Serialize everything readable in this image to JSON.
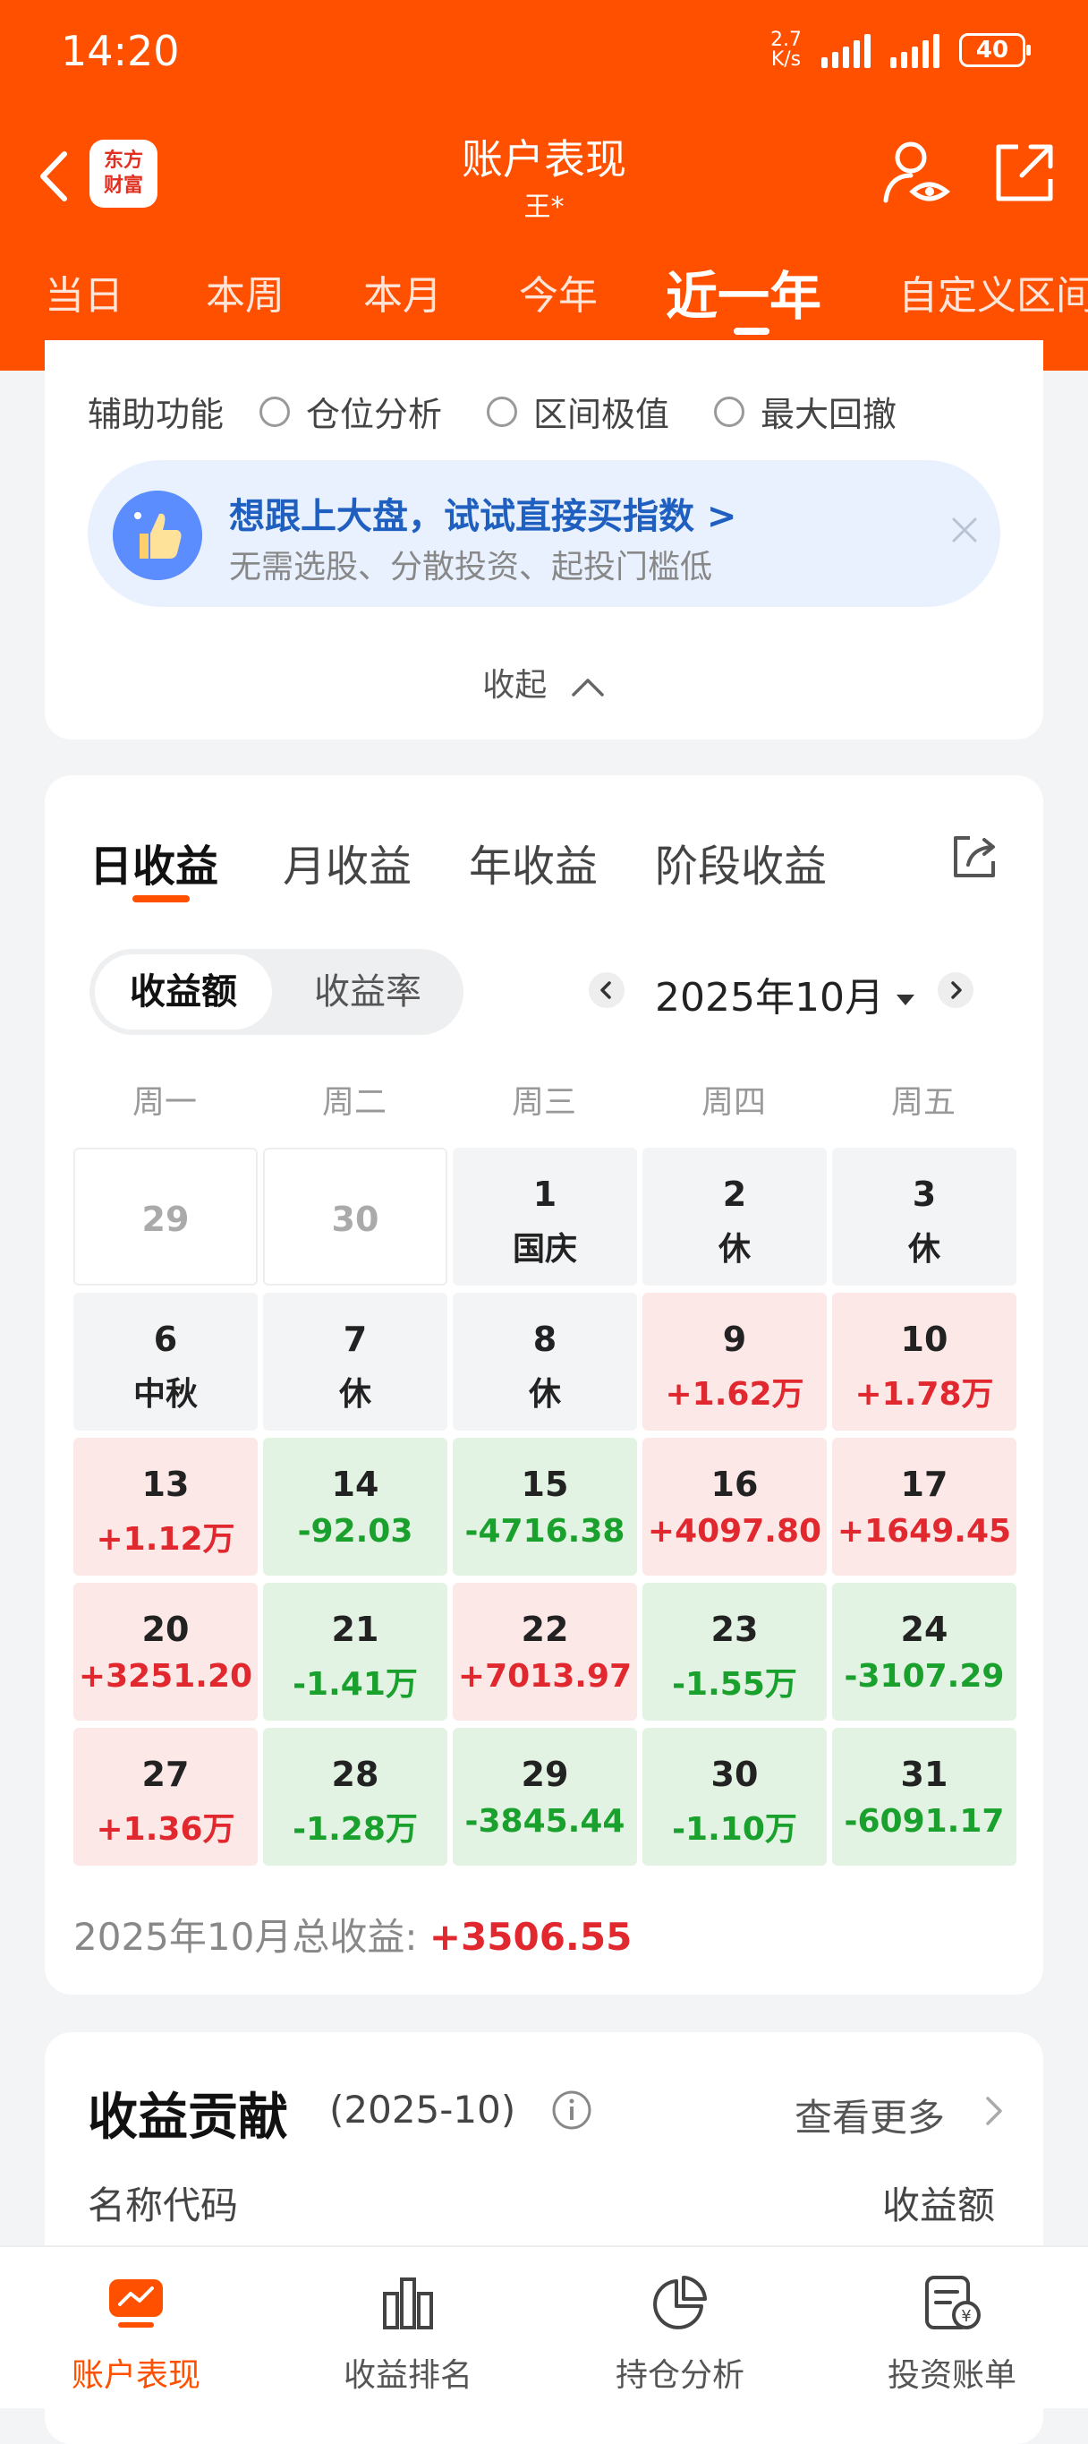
{
  "status_bar": {
    "time": "14:20",
    "net_speed": "2.7\nK/s",
    "battery": "40"
  },
  "header": {
    "brand_logo_lines": [
      "东方",
      "财富"
    ],
    "title": "账户表现",
    "subtitle": "王*",
    "icons": [
      "back-icon",
      "user-eye-icon",
      "share-icon"
    ]
  },
  "period_tabs": [
    "当日",
    "本周",
    "本月",
    "今年",
    "近一年",
    "自定义区间"
  ],
  "period_active": "近一年",
  "assist": {
    "label": "辅助功能",
    "options": [
      "仓位分析",
      "区间极值",
      "最大回撤"
    ]
  },
  "promo": {
    "title": "想跟上大盘，试试直接买指数 >",
    "subtitle": "无需选股、分散投资、起投门槛低"
  },
  "collapse_label": "收起",
  "earnings": {
    "tabs": [
      "日收益",
      "月收益",
      "年收益",
      "阶段收益"
    ],
    "active_tab": "日收益",
    "segment": [
      "收益额",
      "收益率"
    ],
    "active_segment": "收益额",
    "month": "2025年10月",
    "weekdays": [
      "周一",
      "周二",
      "周三",
      "周四",
      "周五"
    ],
    "calendar": [
      [
        {
          "day": "29",
          "val": "",
          "type": "out"
        },
        {
          "day": "30",
          "val": "",
          "type": "out"
        },
        {
          "day": "1",
          "val": "国庆",
          "type": "rest"
        },
        {
          "day": "2",
          "val": "休",
          "type": "rest"
        },
        {
          "day": "3",
          "val": "休",
          "type": "rest"
        }
      ],
      [
        {
          "day": "6",
          "val": "中秋",
          "type": "rest"
        },
        {
          "day": "7",
          "val": "休",
          "type": "rest"
        },
        {
          "day": "8",
          "val": "休",
          "type": "rest"
        },
        {
          "day": "9",
          "val": "+1.62万",
          "type": "up"
        },
        {
          "day": "10",
          "val": "+1.78万",
          "type": "up"
        }
      ],
      [
        {
          "day": "13",
          "val": "+1.12万",
          "type": "up"
        },
        {
          "day": "14",
          "val": "-92.03",
          "type": "down"
        },
        {
          "day": "15",
          "val": "-4716.38",
          "type": "down"
        },
        {
          "day": "16",
          "val": "+4097.80",
          "type": "up"
        },
        {
          "day": "17",
          "val": "+1649.45",
          "type": "up"
        }
      ],
      [
        {
          "day": "20",
          "val": "+3251.20",
          "type": "up"
        },
        {
          "day": "21",
          "val": "-1.41万",
          "type": "down"
        },
        {
          "day": "22",
          "val": "+7013.97",
          "type": "up"
        },
        {
          "day": "23",
          "val": "-1.55万",
          "type": "down"
        },
        {
          "day": "24",
          "val": "-3107.29",
          "type": "down"
        }
      ],
      [
        {
          "day": "27",
          "val": "+1.36万",
          "type": "up"
        },
        {
          "day": "28",
          "val": "-1.28万",
          "type": "down"
        },
        {
          "day": "29",
          "val": "-3845.44",
          "type": "down"
        },
        {
          "day": "30",
          "val": "-1.10万",
          "type": "down"
        },
        {
          "day": "31",
          "val": "-6091.17",
          "type": "down"
        }
      ]
    ],
    "total_label": "2025年10月总收益: ",
    "total_value": "+3506.55"
  },
  "contribution": {
    "title": "收益贡献",
    "period": "(2025-10)",
    "see_more": "查看更多",
    "col_name": "名称代码",
    "col_amount": "收益额"
  },
  "bottom_nav": [
    "账户表现",
    "收益排名",
    "持仓分析",
    "投资账单"
  ],
  "bottom_nav_active": "账户表现",
  "colors": {
    "brand": "#ff5000",
    "up": "#e0282e",
    "down": "#1aa02c",
    "promo_title": "#1f5fbf"
  }
}
